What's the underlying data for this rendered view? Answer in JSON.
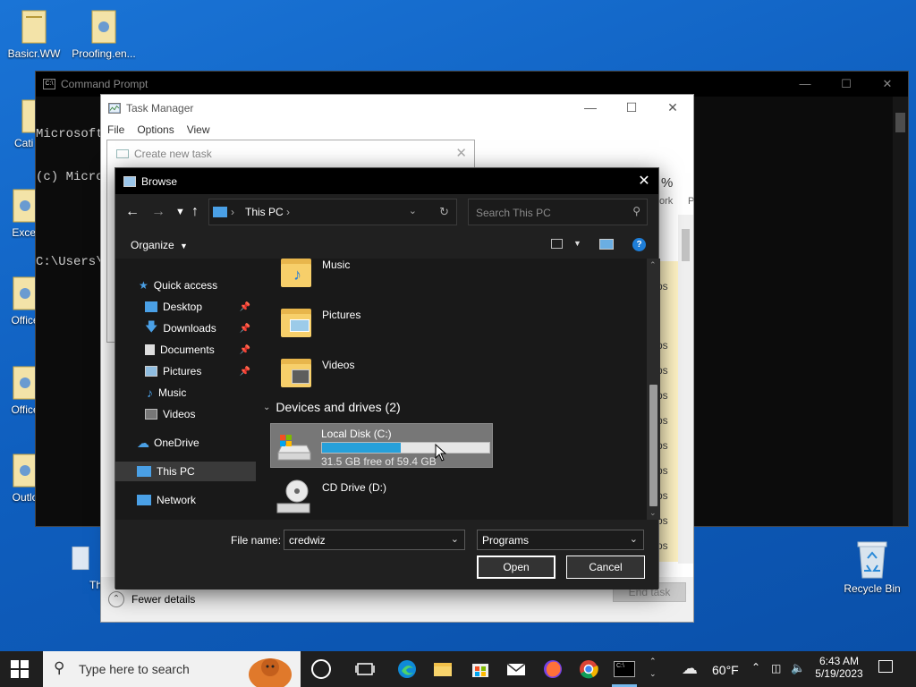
{
  "desktop": {
    "icons": [
      {
        "label": "Basicr.WW"
      },
      {
        "label": "Proofing.en..."
      },
      {
        "label": "Cati"
      },
      {
        "label": "Excel"
      },
      {
        "label": "Office"
      },
      {
        "label": "Office"
      },
      {
        "label": "Outlo"
      },
      {
        "label": "Th"
      },
      {
        "label": "Recycle Bin"
      }
    ]
  },
  "cmd": {
    "title": "Command Prompt",
    "lines": [
      "Microsoft",
      "(c) Micro",
      "C:\\Users\\"
    ]
  },
  "taskmanager": {
    "title": "Task Manager",
    "menu": [
      "File",
      "Options",
      "View"
    ],
    "col_percent": "%",
    "col_work": "ork",
    "col_p": "P",
    "fewer_details": "Fewer details",
    "end_task": "End task",
    "strip_items": [
      "ps",
      "ps",
      "ps",
      "ps",
      "ps",
      "ps",
      "ps",
      "ps",
      "ps",
      "ps",
      "ps",
      "ps"
    ]
  },
  "create_task": {
    "title": "Create new task"
  },
  "browse": {
    "title": "Browse",
    "address": "This PC",
    "search_placeholder": "Search This PC",
    "organize": "Organize",
    "sidebar": [
      {
        "label": "Quick access"
      },
      {
        "label": "Desktop"
      },
      {
        "label": "Downloads"
      },
      {
        "label": "Documents"
      },
      {
        "label": "Pictures"
      },
      {
        "label": "Music"
      },
      {
        "label": "Videos"
      },
      {
        "label": "OneDrive"
      },
      {
        "label": "This PC"
      },
      {
        "label": "Network"
      }
    ],
    "folders": [
      {
        "label": "Music"
      },
      {
        "label": "Pictures"
      },
      {
        "label": "Videos"
      }
    ],
    "devices_header": "Devices and drives (2)",
    "drive_c": {
      "name": "Local Disk (C:)",
      "free": "31.5 GB free of 59.4 GB",
      "used_fraction": 0.47
    },
    "drive_d": {
      "name": "CD Drive (D:)"
    },
    "filename_label": "File name:",
    "filename_value": "credwiz",
    "filter_value": "Programs",
    "open": "Open",
    "cancel": "Cancel"
  },
  "taskbar": {
    "search_placeholder": "Type here to search",
    "temperature": "60°F",
    "time": "6:43 AM",
    "date": "5/19/2023"
  },
  "colors": {
    "accent": "#26a0da",
    "desktop": "#0f5fbf",
    "dialog_bg": "#202020"
  }
}
